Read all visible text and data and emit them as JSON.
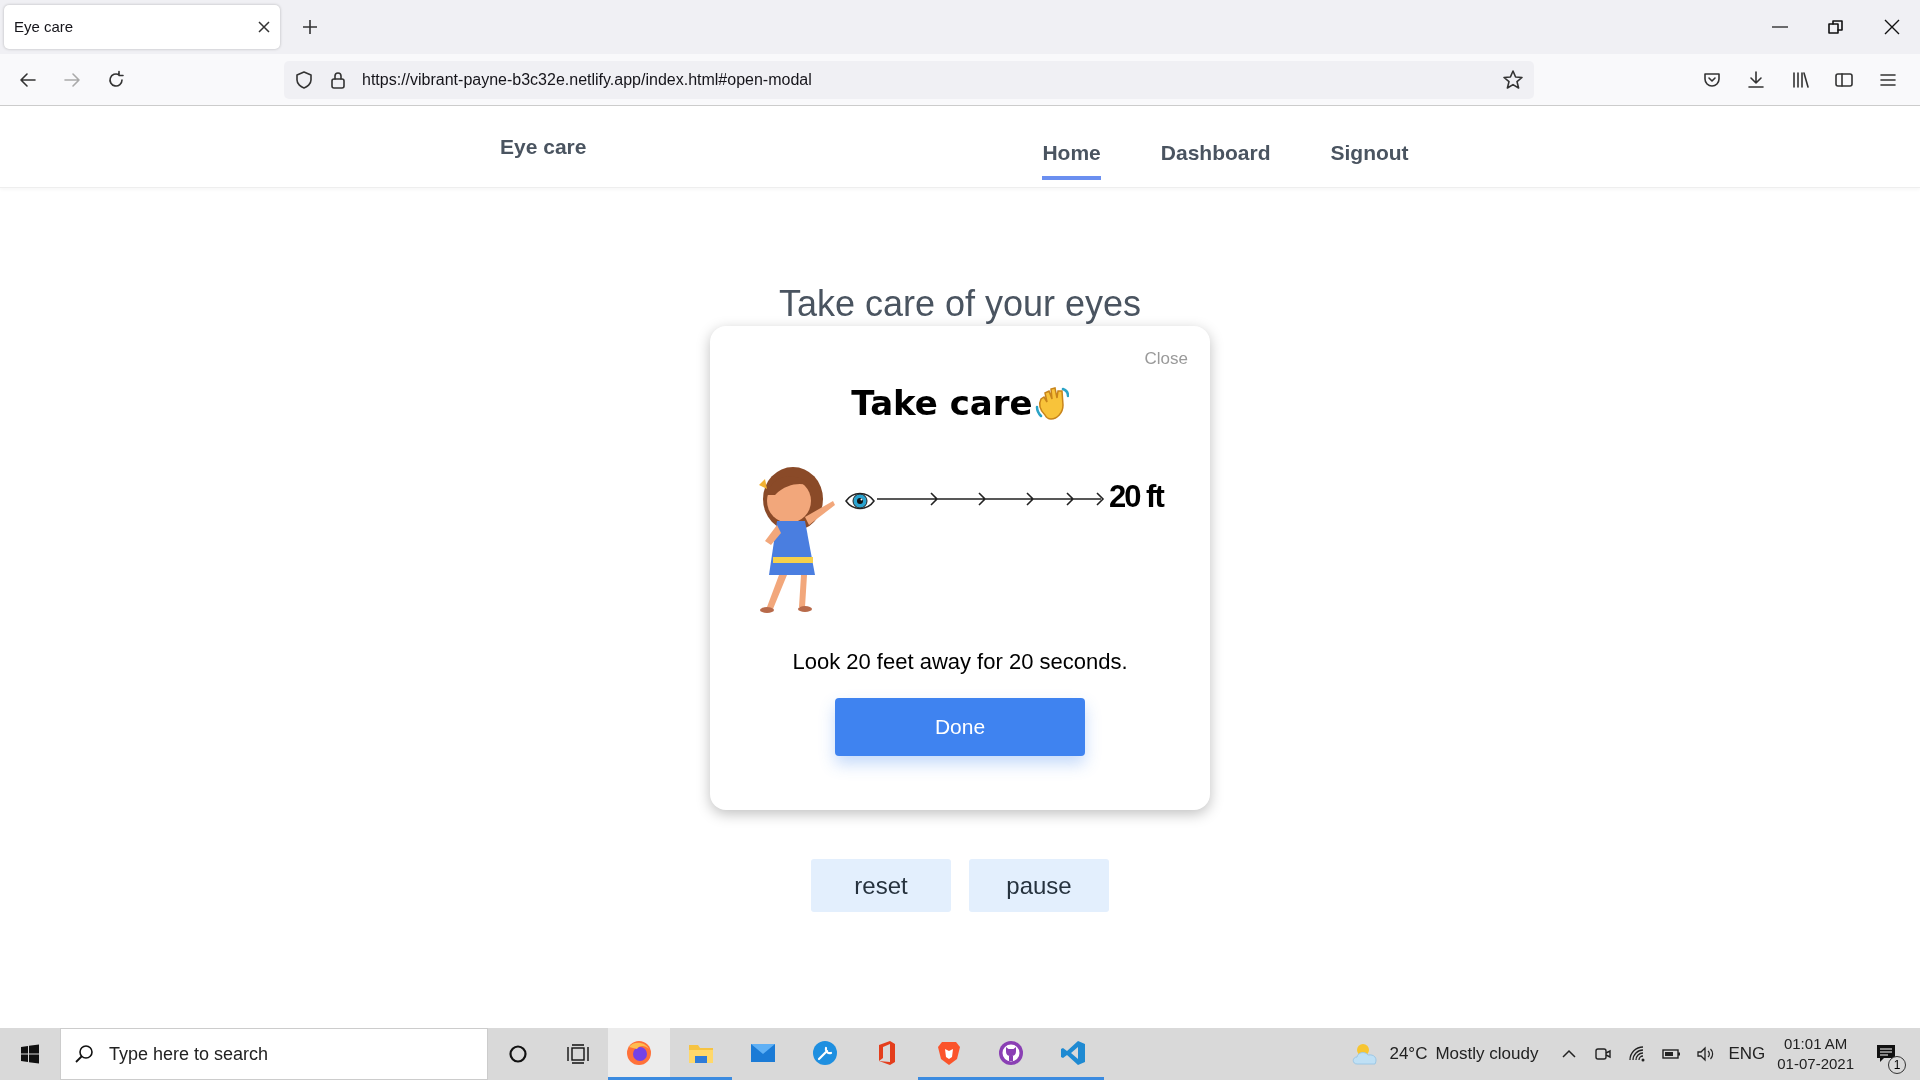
{
  "browser": {
    "tabs": [
      {
        "title": "Eye care",
        "selected": true
      }
    ],
    "url": "https://vibrant-payne-b3c32e.netlify.app/index.html#open-modal"
  },
  "navbar": {
    "brand": "Eye care",
    "links": [
      {
        "label": "Home",
        "selected": true
      },
      {
        "label": "Dashboard",
        "selected": false
      },
      {
        "label": "Signout",
        "selected": false
      }
    ]
  },
  "page": {
    "heading": "Take care of your eyes",
    "buttons": [
      "reset",
      "pause"
    ]
  },
  "modal": {
    "close": "Close",
    "title": "Take care",
    "distance_label": "20 ft",
    "message": "Look 20 feet away for 20 seconds.",
    "button": "Done"
  },
  "taskbar": {
    "search": {
      "placeholder": "Type here to search"
    },
    "apps": [
      {
        "kind": "firefox",
        "running": true,
        "selected": true
      },
      {
        "kind": "files",
        "running": true,
        "selected": false
      },
      {
        "kind": "mail",
        "running": false,
        "selected": false
      },
      {
        "kind": "wrench",
        "running": false,
        "selected": false
      },
      {
        "kind": "office",
        "running": false,
        "selected": false
      },
      {
        "kind": "brave",
        "running": true,
        "selected": false
      },
      {
        "kind": "github",
        "running": true,
        "selected": false
      },
      {
        "kind": "vscode",
        "running": true,
        "selected": false
      }
    ],
    "weather": {
      "temperature": "24°C",
      "condition": "Mostly cloudy"
    },
    "language": "ENG",
    "time": "01:01 AM",
    "date": "01-07-2021",
    "notifications": "1"
  }
}
